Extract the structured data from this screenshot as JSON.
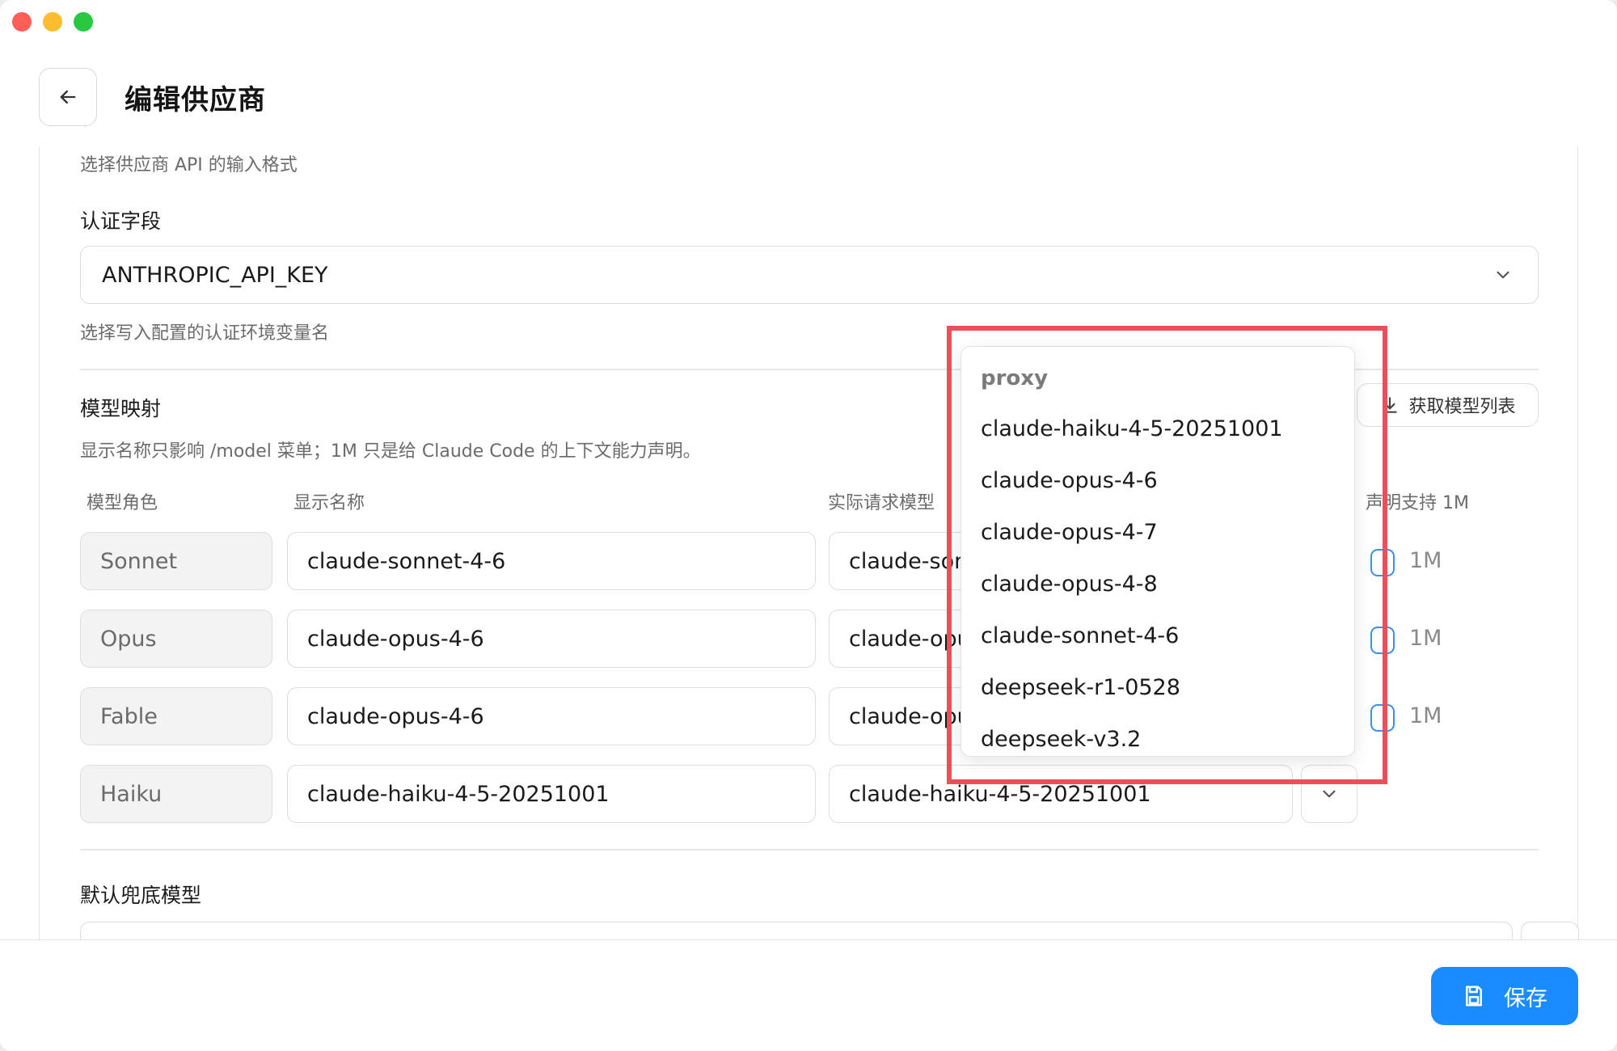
{
  "header": {
    "title": "编辑供应商"
  },
  "api_format": {
    "hint": "选择供应商 API 的输入格式"
  },
  "auth_field": {
    "label": "认证字段",
    "value": "ANTHROPIC_API_KEY",
    "hint": "选择写入配置的认证环境变量名"
  },
  "model_mapping": {
    "title": "模型映射",
    "description": "显示名称只影响 /model 菜单；1M 只是给 Claude Code 的上下文能力声明。",
    "fetch_button": "获取模型列表",
    "columns": {
      "role": "模型角色",
      "display": "显示名称",
      "actual": "实际请求模型",
      "support": "声明支持 1M"
    },
    "rows": [
      {
        "role": "Sonnet",
        "display": "claude-sonnet-4-6",
        "actual": "claude-sonnet-4-6",
        "check_label": "1M"
      },
      {
        "role": "Opus",
        "display": "claude-opus-4-6",
        "actual": "claude-opus-4-6",
        "check_label": "1M"
      },
      {
        "role": "Fable",
        "display": "claude-opus-4-6",
        "actual": "claude-opus-4-6",
        "check_label": "1M"
      },
      {
        "role": "Haiku",
        "display": "claude-haiku-4-5-20251001",
        "actual": "claude-haiku-4-5-20251001"
      }
    ]
  },
  "dropdown": {
    "group": "proxy",
    "options": [
      "claude-haiku-4-5-20251001",
      "claude-opus-4-6",
      "claude-opus-4-7",
      "claude-opus-4-8",
      "claude-sonnet-4-6",
      "deepseek-r1-0528",
      "deepseek-v3.2"
    ]
  },
  "default_model": {
    "label": "默认兜底模型"
  },
  "footer": {
    "save_label": "保存"
  },
  "colors": {
    "accent": "#1a8cff",
    "highlight": "#ec4f55",
    "checkbox": "#3a8ff0"
  }
}
